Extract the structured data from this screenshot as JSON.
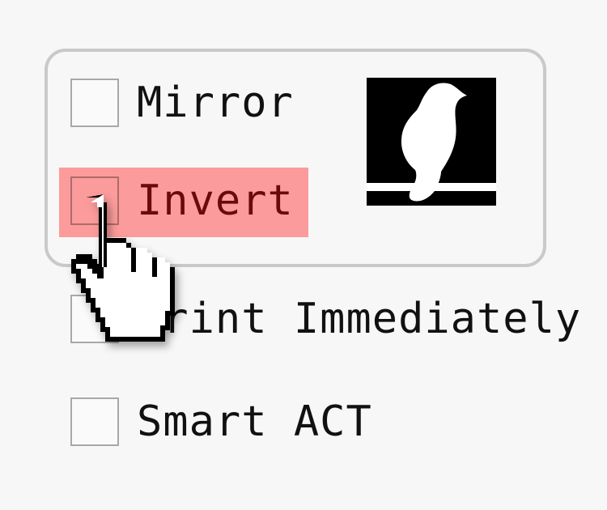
{
  "options": [
    {
      "label": "Mirror",
      "checked": false
    },
    {
      "label": "Invert",
      "checked": false,
      "highlighted": true
    },
    {
      "label": "Print Immediately",
      "checked": false
    },
    {
      "label": "Smart ACT",
      "checked": false
    }
  ],
  "preview": {
    "icon": "bird-silhouette-icon"
  },
  "cursor": {
    "icon": "hand-pointer-icon"
  },
  "colors": {
    "background": "#f7f7f7",
    "highlight": "#ff5050",
    "group_border": "#c9c9c9",
    "text": "#111111"
  }
}
